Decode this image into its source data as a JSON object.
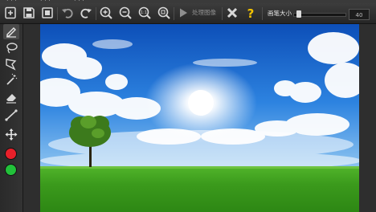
{
  "toolbar": {
    "buttons": [
      {
        "name": "open-image-icon"
      },
      {
        "name": "save-icon"
      },
      {
        "name": "save-as-icon"
      },
      {
        "name": "undo-icon"
      },
      {
        "name": "redo-icon"
      },
      {
        "name": "zoom-in-icon"
      },
      {
        "name": "zoom-out-icon"
      },
      {
        "name": "actual-size-icon",
        "label": "1:1"
      },
      {
        "name": "fit-window-icon"
      }
    ],
    "process_label": "处理图像",
    "close_icon": "close-x-icon",
    "help_icon": "help-question-icon",
    "brush_size_label": "画笔大小",
    "brush_size_value": "40",
    "brush_slider_fraction": 0.05
  },
  "sidebar": {
    "tools": [
      {
        "name": "brush-tool",
        "icon": "pencil-icon",
        "active": true
      },
      {
        "name": "lasso-tool",
        "icon": "lasso-icon"
      },
      {
        "name": "polygon-lasso-tool",
        "icon": "polygon-lasso-icon"
      },
      {
        "name": "magic-wand-tool",
        "icon": "magic-wand-icon"
      },
      {
        "name": "eraser-tool",
        "icon": "eraser-icon"
      },
      {
        "name": "line-tool",
        "icon": "line-icon"
      },
      {
        "name": "move-tool",
        "icon": "move-icon"
      }
    ],
    "colors": {
      "remove_marker": "#e8202a",
      "keep_marker": "#22c13a"
    }
  },
  "canvas": {
    "image": "landscape-photo"
  },
  "colors": {
    "toolbar_bg": "#2f2f2f",
    "icon": "#d8d8d8",
    "help": "#f2c200",
    "sky": "#1a6fd6",
    "grass": "#3a9a1c"
  }
}
